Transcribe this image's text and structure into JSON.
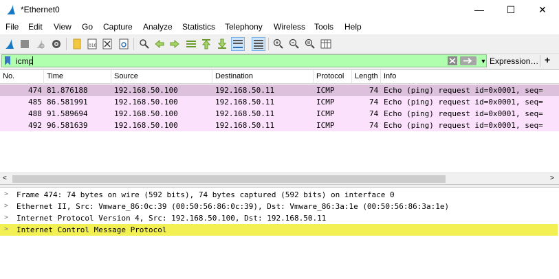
{
  "window": {
    "title": "*Ethernet0",
    "min_icon": "minimize-icon",
    "max_icon": "maximize-icon",
    "close_icon": "close-icon",
    "min_label": "—",
    "max_label": "☐",
    "close_label": "✕"
  },
  "menu": [
    "File",
    "Edit",
    "View",
    "Go",
    "Capture",
    "Analyze",
    "Statistics",
    "Telephony",
    "Wireless",
    "Tools",
    "Help"
  ],
  "toolbar_icons": [
    "start-capture-icon",
    "stop-capture-icon",
    "restart-capture-icon",
    "capture-options-icon",
    "open-file-icon",
    "save-file-icon",
    "close-file-icon",
    "reload-file-icon",
    "find-packet-icon",
    "go-back-icon",
    "go-forward-icon",
    "go-to-packet-icon",
    "go-first-icon",
    "go-last-icon",
    "auto-scroll-icon",
    "colorize-icon",
    "zoom-in-icon",
    "zoom-out-icon",
    "zoom-normal-icon",
    "resize-columns-icon"
  ],
  "filter": {
    "value": "icmp",
    "expression_label": "Expression…",
    "add_label": "+",
    "clear_icon": "clear-filter-icon",
    "apply_icon": "apply-filter-icon",
    "dropdown_icon": "chevron-down-icon"
  },
  "colors": {
    "filter_bg": "#afffaf",
    "row_selected": "#dcc0dc",
    "row_icmp": "#fbe1fb",
    "highlight": "#f3f054"
  },
  "packet_columns": [
    "No.",
    "Time",
    "Source",
    "Destination",
    "Protocol",
    "Length",
    "Info"
  ],
  "packets": [
    {
      "no": "474",
      "time": "81.876188",
      "source": "192.168.50.100",
      "destination": "192.168.50.11",
      "protocol": "ICMP",
      "length": "74",
      "info": "Echo (ping) request  id=0x0001, seq="
    },
    {
      "no": "485",
      "time": "86.581991",
      "source": "192.168.50.100",
      "destination": "192.168.50.11",
      "protocol": "ICMP",
      "length": "74",
      "info": "Echo (ping) request  id=0x0001, seq="
    },
    {
      "no": "488",
      "time": "91.589694",
      "source": "192.168.50.100",
      "destination": "192.168.50.11",
      "protocol": "ICMP",
      "length": "74",
      "info": "Echo (ping) request  id=0x0001, seq="
    },
    {
      "no": "492",
      "time": "96.581639",
      "source": "192.168.50.100",
      "destination": "192.168.50.11",
      "protocol": "ICMP",
      "length": "74",
      "info": "Echo (ping) request  id=0x0001, seq="
    }
  ],
  "scroll": {
    "left_arrow": "<",
    "right_arrow": ">"
  },
  "details": [
    {
      "text": "Frame 474: 74 bytes on wire (592 bits), 74 bytes captured (592 bits) on interface 0",
      "highlighted": false
    },
    {
      "text": "Ethernet II, Src: Vmware_86:0c:39 (00:50:56:86:0c:39), Dst: Vmware_86:3a:1e (00:50:56:86:3a:1e)",
      "highlighted": false
    },
    {
      "text": "Internet Protocol Version 4, Src: 192.168.50.100, Dst: 192.168.50.11",
      "highlighted": false
    },
    {
      "text": "Internet Control Message Protocol",
      "highlighted": true
    }
  ],
  "detail_arrow": ">"
}
